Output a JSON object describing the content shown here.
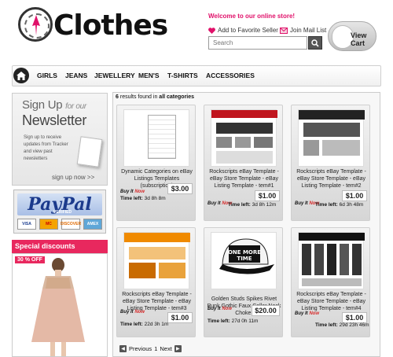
{
  "header": {
    "brand": "Clothes",
    "welcome": "Welcome to our online store!",
    "favorite_label": "Add to Favorite Seller",
    "mail_label": "Join Mail List",
    "search_placeholder": "Search",
    "cart_label": "View Cart"
  },
  "nav": {
    "items": [
      "GIRLS",
      "JEANS",
      "JEWELLERY",
      "MEN'S",
      "T-SHIRTS",
      "ACCESSORIES"
    ]
  },
  "sidebar": {
    "newsletter": {
      "line1": "Sign Up",
      "line1_suffix": "for our",
      "title": "Newsletter",
      "body": "Sign up to receive updates from Tracker and view past newsletters",
      "link": "sign up now >>"
    },
    "paypal": {
      "logo": "PayPal",
      "verified": "VERIFIED",
      "cards": [
        "VISA",
        "MC",
        "DISCOVER",
        "AMEX"
      ]
    },
    "special": {
      "title": "Special discounts",
      "badge": "30 % OFF"
    }
  },
  "results": {
    "count": "6",
    "text": "results found in",
    "category": "all categories"
  },
  "buy_now": {
    "a": "Buy It",
    "b": "Now"
  },
  "time_left_label": "Time left:",
  "products": [
    {
      "title": "Dynamic Categories on eBay Listings Templates (subscription)",
      "price": "$3.00",
      "time": "3d 8h 8m"
    },
    {
      "title": "Rockscripts eBay Template - eBay Store Template - eBay Listing Template - tem#1",
      "price": "$1.00",
      "time": "3d 8h 12m"
    },
    {
      "title": "Rockscripts eBay Template - eBay Store Template - eBay Listing Template - tem#2",
      "price": "$1.00",
      "time": "6d 3h 48m"
    },
    {
      "title": "Rockscripts eBay Template - eBay Store Template - eBay Listing Template - tem#3",
      "price": "$1.00",
      "time": "22d 3h 1m"
    },
    {
      "title": "Golden Studs Spikes Rivet Punk Gothic Faux Collar Neck Choker",
      "price": "$20.00",
      "time": "27d 0h 11m"
    },
    {
      "title": "Rockscripts eBay Template - eBay Store Template - eBay Listing Template - tem#4",
      "price": "$1.00",
      "time": "29d 23h 46m"
    }
  ],
  "pager": {
    "previous": "Previous",
    "page": "1",
    "next": "Next"
  },
  "colors": {
    "accent": "#e8285e",
    "dark": "#222222"
  }
}
